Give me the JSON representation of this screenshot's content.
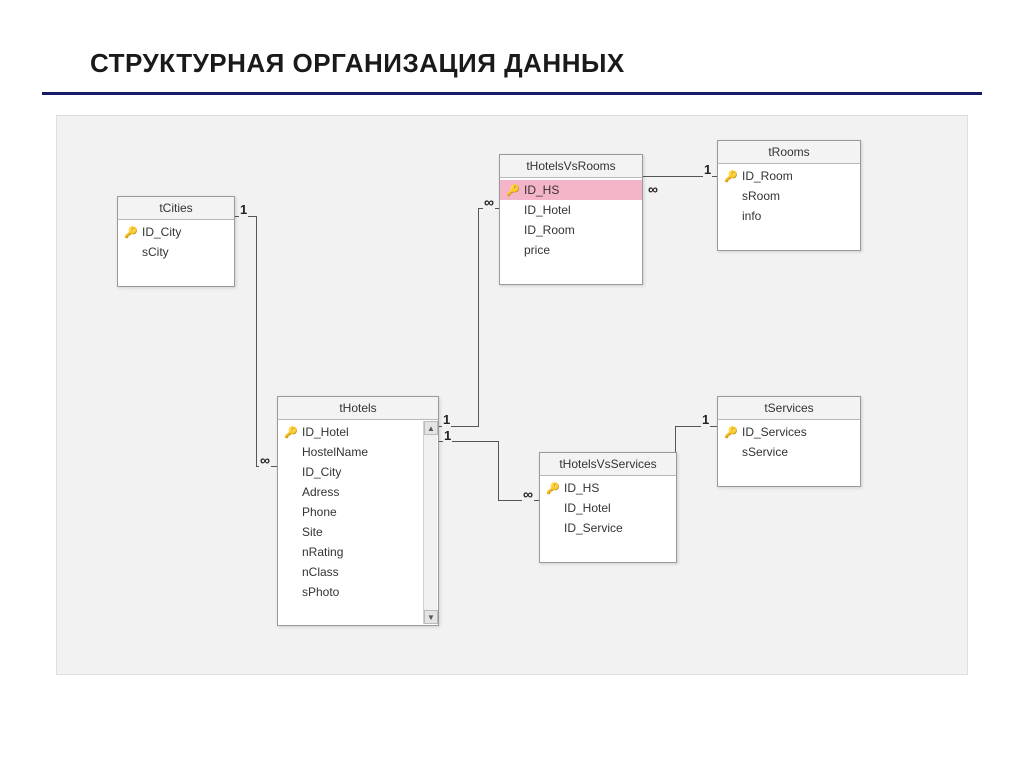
{
  "title": "СТРУКТУРНАЯ ОРГАНИЗАЦИЯ ДАННЫХ",
  "tables": {
    "tCities": {
      "name": "tCities",
      "fields": [
        {
          "name": "ID_City",
          "pk": true
        },
        {
          "name": "sCity",
          "pk": false
        }
      ]
    },
    "tHotelsVsRooms": {
      "name": "tHotelsVsRooms",
      "fields": [
        {
          "name": "ID_HS",
          "pk": true,
          "highlight": true
        },
        {
          "name": "ID_Hotel",
          "pk": false
        },
        {
          "name": "ID_Room",
          "pk": false
        },
        {
          "name": "price",
          "pk": false
        }
      ]
    },
    "tRooms": {
      "name": "tRooms",
      "fields": [
        {
          "name": "ID_Room",
          "pk": true
        },
        {
          "name": "sRoom",
          "pk": false
        },
        {
          "name": "info",
          "pk": false
        }
      ]
    },
    "tHotels": {
      "name": "tHotels",
      "fields": [
        {
          "name": "ID_Hotel",
          "pk": true
        },
        {
          "name": "HostelName",
          "pk": false
        },
        {
          "name": "ID_City",
          "pk": false
        },
        {
          "name": "Adress",
          "pk": false
        },
        {
          "name": "Phone",
          "pk": false
        },
        {
          "name": "Site",
          "pk": false
        },
        {
          "name": "nRating",
          "pk": false
        },
        {
          "name": "nClass",
          "pk": false
        },
        {
          "name": "sPhoto",
          "pk": false
        }
      ],
      "hasScrollbar": true
    },
    "tHotelsVsServices": {
      "name": "tHotelsVsServices",
      "fields": [
        {
          "name": "ID_HS",
          "pk": true
        },
        {
          "name": "ID_Hotel",
          "pk": false
        },
        {
          "name": "ID_Service",
          "pk": false
        }
      ]
    },
    "tServices": {
      "name": "tServices",
      "fields": [
        {
          "name": "ID_Services",
          "pk": true
        },
        {
          "name": "sService",
          "pk": false
        }
      ]
    }
  },
  "relationships": [
    {
      "from": "tCities.ID_City",
      "to": "tHotels.ID_City",
      "fromCard": "1",
      "toCard": "∞"
    },
    {
      "from": "tHotels.ID_Hotel",
      "to": "tHotelsVsRooms.ID_Hotel",
      "fromCard": "1",
      "toCard": "∞"
    },
    {
      "from": "tRooms.ID_Room",
      "to": "tHotelsVsRooms.ID_Room",
      "fromCard": "1",
      "toCard": "∞"
    },
    {
      "from": "tHotels.ID_Hotel",
      "to": "tHotelsVsServices.ID_Hotel",
      "fromCard": "1",
      "toCard": "∞"
    },
    {
      "from": "tServices.ID_Services",
      "to": "tHotelsVsServices.ID_Service",
      "fromCard": "1",
      "toCard": "∞"
    }
  ],
  "cardLabels": {
    "one": "1",
    "many": "∞"
  }
}
